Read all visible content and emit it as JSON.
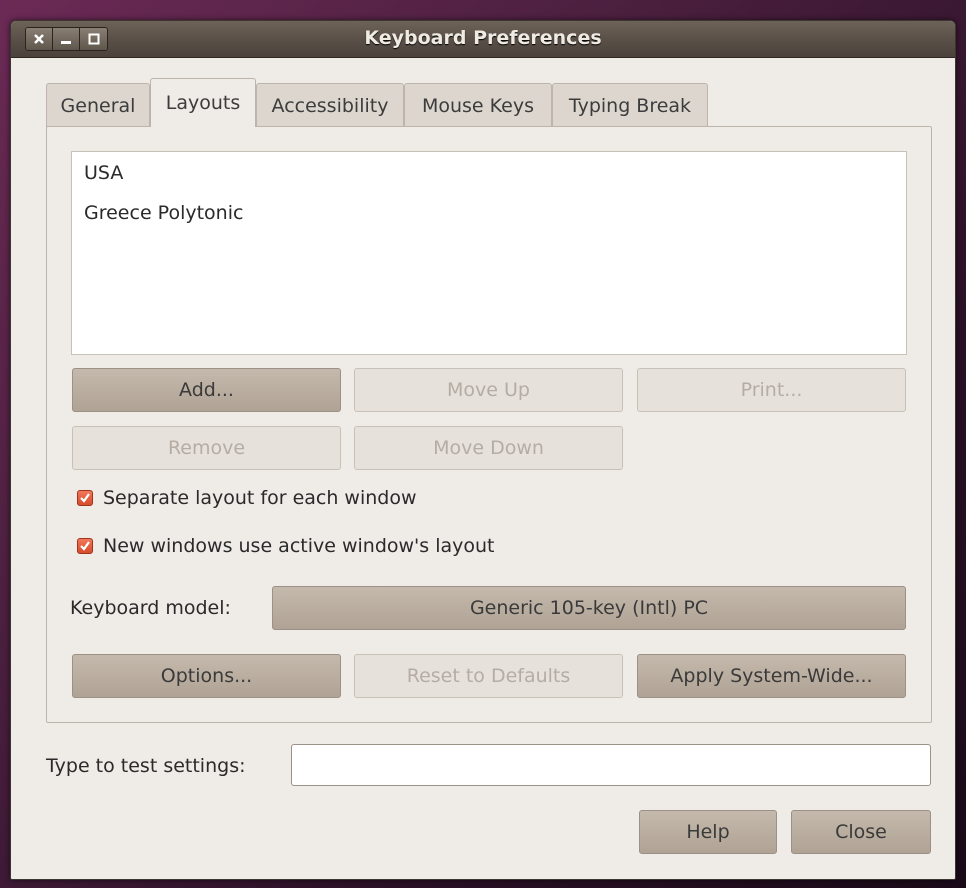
{
  "window": {
    "title": "Keyboard Preferences"
  },
  "tabs": [
    {
      "label": "General"
    },
    {
      "label": "Layouts"
    },
    {
      "label": "Accessibility"
    },
    {
      "label": "Mouse Keys"
    },
    {
      "label": "Typing Break"
    }
  ],
  "active_tab": "Layouts",
  "layouts": {
    "items": [
      "USA",
      "Greece Polytonic"
    ],
    "add_label": "Add...",
    "move_up_label": "Move Up",
    "print_label": "Print...",
    "remove_label": "Remove",
    "move_down_label": "Move Down"
  },
  "options": {
    "separate_layout_label": "Separate layout for each window",
    "separate_layout_checked": true,
    "new_windows_label": "New windows use active window's layout",
    "new_windows_checked": true
  },
  "keyboard_model": {
    "label": "Keyboard model:",
    "value": "Generic 105-key (Intl) PC"
  },
  "actions": {
    "options_label": "Options...",
    "reset_label": "Reset to Defaults",
    "apply_label": "Apply System-Wide..."
  },
  "test": {
    "label": "Type to test settings:",
    "value": ""
  },
  "footer": {
    "help_label": "Help",
    "close_label": "Close"
  }
}
